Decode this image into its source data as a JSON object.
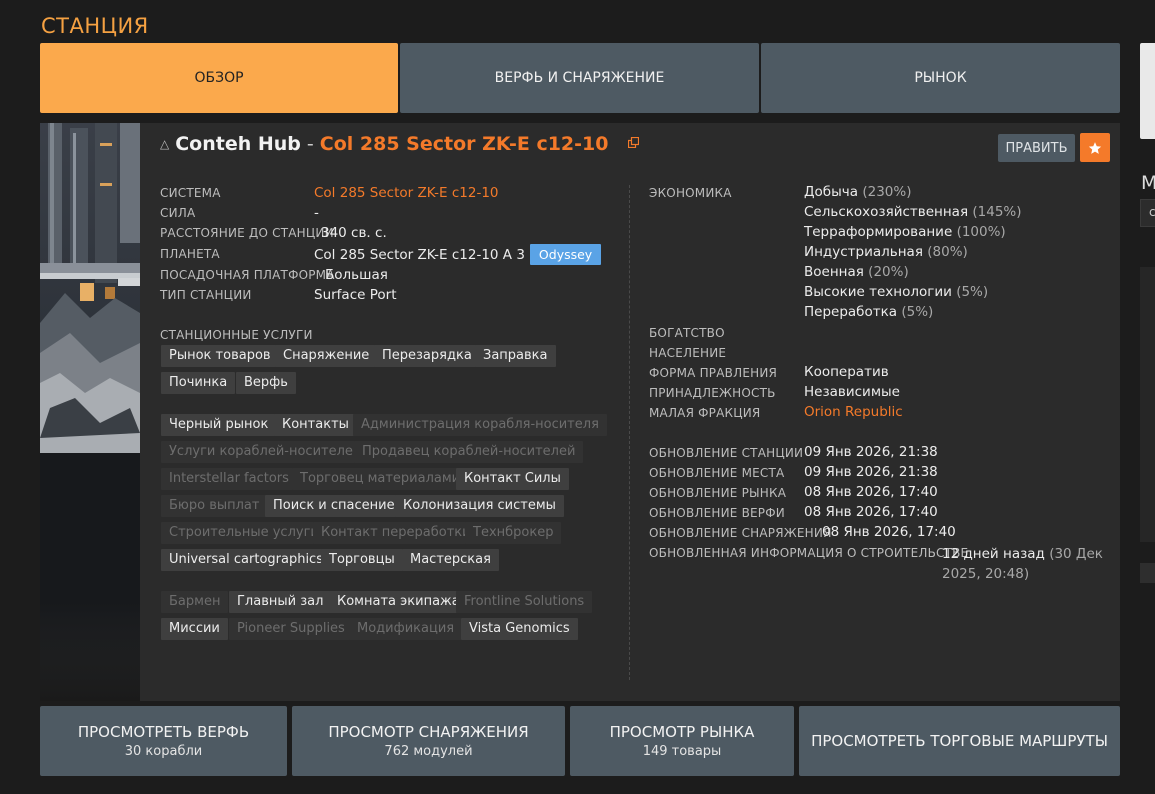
{
  "page_title": "СТАНЦИЯ",
  "tabs": [
    {
      "label": "ОБЗОР",
      "active": true
    },
    {
      "label": "ВЕРФЬ И СНАРЯЖЕНИЕ",
      "active": false
    },
    {
      "label": "РЫНОК",
      "active": false
    }
  ],
  "right_edge": {
    "letter": "М",
    "field_char": "с"
  },
  "station": {
    "icon": "station-icon",
    "name": "Conteh Hub",
    "separator": "-",
    "system_name": "Col 285 Sector ZK-E c12-10",
    "edit_label": "ПРАВИТЬ",
    "favorite_icon": "star-icon"
  },
  "details": {
    "system_label": "СИСТЕМА",
    "system_value": "Col 285 Sector ZK-E c12-10",
    "power_label": "СИЛА",
    "power_value": "-",
    "distance_label": "РАССТОЯНИЕ ДО СТАНЦИИ",
    "distance_value": "340 св. с.",
    "planet_label": "ПЛАНЕТА",
    "planet_value": "Col 285 Sector ZK-E c12-10 A 3",
    "planet_badge": "Odyssey",
    "pad_label": "ПОСАДОЧНАЯ ПЛАТФОРМА",
    "pad_value": "Большая",
    "type_label": "ТИП СТАНЦИИ",
    "type_value": "Surface Port",
    "services_label": "СТАНЦИОННЫЕ УСЛУГИ"
  },
  "services_group1": [
    {
      "label": "Рынок товаров",
      "active": true
    },
    {
      "label": "Снаряжение",
      "active": true
    },
    {
      "label": "Перезарядка",
      "active": true
    },
    {
      "label": "Заправка",
      "active": true
    },
    {
      "label": "Починка",
      "active": true
    },
    {
      "label": "Верфь",
      "active": true
    }
  ],
  "services_group2": [
    {
      "label": "Черный рынок",
      "active": true
    },
    {
      "label": "Контакты",
      "active": true
    },
    {
      "label": "Администрация корабля-носителя",
      "active": false
    },
    {
      "label": "Услуги кораблей-носителей",
      "active": false
    },
    {
      "label": "Продавец кораблей-носителей",
      "active": false
    },
    {
      "label": "Interstellar factors",
      "active": false
    },
    {
      "label": "Торговец материалами",
      "active": false
    },
    {
      "label": "Контакт Силы",
      "active": true
    },
    {
      "label": "Бюро выплат",
      "active": false
    },
    {
      "label": "Поиск и спасение",
      "active": true
    },
    {
      "label": "Колонизация системы",
      "active": true
    },
    {
      "label": "Строительные услуги",
      "active": false
    },
    {
      "label": "Контакт переработки",
      "active": false
    },
    {
      "label": "Технброкер",
      "active": false
    },
    {
      "label": "Universal cartographics",
      "active": true
    },
    {
      "label": "Торговцы",
      "active": true
    },
    {
      "label": "Мастерская",
      "active": true
    }
  ],
  "services_group3": [
    {
      "label": "Бармен",
      "active": false
    },
    {
      "label": "Главный зал",
      "active": true
    },
    {
      "label": "Комната экипажа",
      "active": true
    },
    {
      "label": "Frontline Solutions",
      "active": false
    },
    {
      "label": "Миссии",
      "active": true
    },
    {
      "label": "Pioneer Supplies",
      "active": false
    },
    {
      "label": "Модификация",
      "active": false
    },
    {
      "label": "Vista Genomics",
      "active": true
    }
  ],
  "economy": {
    "label": "ЭКОНОМИКА",
    "items": [
      {
        "name": "Добыча",
        "pct": "(230%)"
      },
      {
        "name": "Сельскохозяйственная",
        "pct": "(145%)"
      },
      {
        "name": "Терраформирование",
        "pct": "(100%)"
      },
      {
        "name": "Индустриальная",
        "pct": "(80%)"
      },
      {
        "name": "Военная",
        "pct": "(20%)"
      },
      {
        "name": "Высокие технологии",
        "pct": "(5%)"
      },
      {
        "name": "Переработка",
        "pct": "(5%)"
      }
    ]
  },
  "faction": {
    "wealth_label": "БОГАТСТВО",
    "population_label": "НАСЕЛЕНИЕ",
    "government_label": "ФОРМА ПРАВЛЕНИЯ",
    "government_value": "Кооператив",
    "allegiance_label": "ПРИНАДЛЕЖНОСТЬ",
    "allegiance_value": "Независимые",
    "minor_faction_label": "МАЛАЯ ФРАКЦИЯ",
    "minor_faction_value": "Orion Republic"
  },
  "updates": {
    "station_label": "ОБНОВЛЕНИЕ СТАНЦИИ",
    "station_value": "09 Янв 2026, 21:38",
    "place_label": "ОБНОВЛЕНИЕ МЕСТА",
    "place_value": "09 Янв 2026, 21:38",
    "market_label": "ОБНОВЛЕНИЕ РЫНКА",
    "market_value": "08 Янв 2026, 17:40",
    "shipyard_label": "ОБНОВЛЕНИЕ ВЕРФИ",
    "shipyard_value": "08 Янв 2026, 17:40",
    "outfitting_label": "ОБНОВЛЕНИЕ СНАРЯЖЕНИЯ",
    "outfitting_value": "08 Янв 2026, 17:40",
    "construction_label": "ОБНОВЛЕННАЯ ИНФОРМАЦИЯ О СТРОИТЕЛЬСТВЕ",
    "construction_value_main": "12 дней назад",
    "construction_value_line1": "(30 Дек",
    "construction_value_line2": "2025, 20:48)"
  },
  "bottom_buttons": [
    {
      "title": "ПРОСМОТРЕТЬ ВЕРФЬ",
      "subtitle": "30 корабли"
    },
    {
      "title": "ПРОСМОТР СНАРЯЖЕНИЯ",
      "subtitle": "762 модулей"
    },
    {
      "title": "ПРОСМОТР РЫНКА",
      "subtitle": "149 товары"
    },
    {
      "title": "ПРОСМОТРЕТЬ ТОРГОВЫЕ МАРШРУТЫ",
      "subtitle": ""
    }
  ],
  "colors": {
    "accent_orange": "#f47a2a",
    "tab_active": "#fba94c",
    "button_slate": "#4e5a63",
    "odyssey_blue": "#5aa3e6"
  }
}
